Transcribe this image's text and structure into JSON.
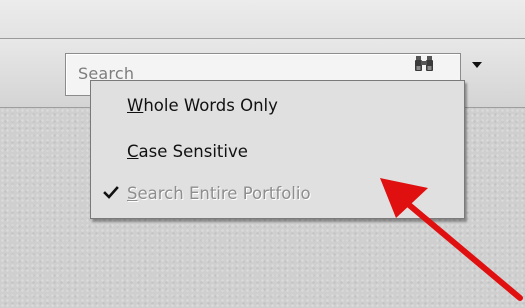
{
  "search": {
    "placeholder": "Search",
    "search_icon": "binoculars-icon",
    "dropdown_icon": "chevron-down-icon"
  },
  "menu": {
    "items": [
      {
        "label_first": "W",
        "label_rest": "hole Words Only",
        "checked": false,
        "enabled": true
      },
      {
        "label_first": "C",
        "label_rest": "ase Sensitive",
        "checked": false,
        "enabled": true
      },
      {
        "label_first": "S",
        "label_rest": "earch Entire Portfolio",
        "checked": true,
        "enabled": false
      }
    ]
  },
  "annotation": {
    "arrow_color": "#e01010",
    "icon": "pointer-arrow-icon"
  },
  "colors": {
    "menu_background": "#e0e0e0",
    "disabled_text": "#8e8e8e"
  }
}
